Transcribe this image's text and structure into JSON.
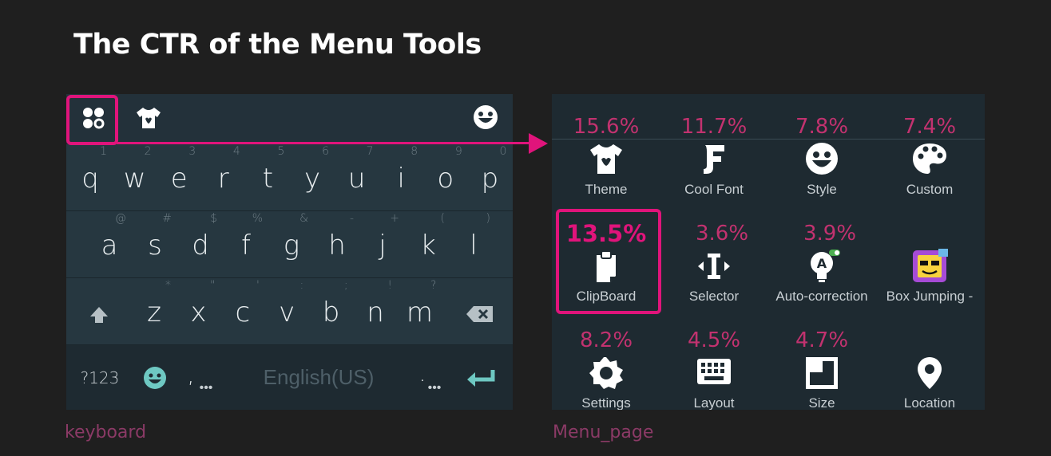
{
  "title": "The CTR of the Menu Tools",
  "captions": {
    "keyboard": "keyboard",
    "menu": "Menu_page"
  },
  "colors": {
    "accent": "#e0147b",
    "percent": "#c2326f",
    "background": "#1f1f1f",
    "keyboard_bg": "#263740"
  },
  "keyboard": {
    "toolbar_icons": [
      "menu-grid-icon",
      "theme-shirt-icon",
      "emoji-face-icon"
    ],
    "row1": [
      {
        "k": "q",
        "h": "1"
      },
      {
        "k": "w",
        "h": "2"
      },
      {
        "k": "e",
        "h": "3"
      },
      {
        "k": "r",
        "h": "4"
      },
      {
        "k": "t",
        "h": "5"
      },
      {
        "k": "y",
        "h": "6"
      },
      {
        "k": "u",
        "h": "7"
      },
      {
        "k": "i",
        "h": "8"
      },
      {
        "k": "o",
        "h": "9"
      },
      {
        "k": "p",
        "h": "0"
      }
    ],
    "row2": [
      {
        "k": "a",
        "h": "@"
      },
      {
        "k": "s",
        "h": "#"
      },
      {
        "k": "d",
        "h": "$"
      },
      {
        "k": "f",
        "h": "%"
      },
      {
        "k": "g",
        "h": "&"
      },
      {
        "k": "h",
        "h": "-"
      },
      {
        "k": "j",
        "h": "+"
      },
      {
        "k": "k",
        "h": "("
      },
      {
        "k": "l",
        "h": ")"
      }
    ],
    "row3": [
      {
        "k": "z",
        "h": "*"
      },
      {
        "k": "x",
        "h": "\""
      },
      {
        "k": "c",
        "h": "'"
      },
      {
        "k": "v",
        "h": ":"
      },
      {
        "k": "b",
        "h": ";"
      },
      {
        "k": "n",
        "h": "!"
      },
      {
        "k": "m",
        "h": "?"
      }
    ],
    "symbols_key": "?123",
    "comma_key": ",",
    "period_key": ".",
    "language": "English(US)"
  },
  "menu": {
    "items": [
      {
        "label": "Theme",
        "ctr": "15.6%",
        "icon": "shirt-icon"
      },
      {
        "label": "Cool Font",
        "ctr": "11.7%",
        "icon": "font-icon"
      },
      {
        "label": "Style",
        "ctr": "7.8%",
        "icon": "smiley-icon"
      },
      {
        "label": "Custom",
        "ctr": "7.4%",
        "icon": "palette-icon"
      },
      {
        "label": "ClipBoard",
        "ctr": "13.5%",
        "icon": "clipboard-icon"
      },
      {
        "label": "Selector",
        "ctr": "3.6%",
        "icon": "text-cursor-icon"
      },
      {
        "label": "Auto-correction",
        "ctr": "3.9%",
        "icon": "bulb-icon"
      },
      {
        "label": "Box Jumping -",
        "ctr": "",
        "icon": "game-ad-icon"
      },
      {
        "label": "Settings",
        "ctr": "8.2%",
        "icon": "gear-icon"
      },
      {
        "label": "Layout",
        "ctr": "4.5%",
        "icon": "keyboard-layout-icon"
      },
      {
        "label": "Size",
        "ctr": "4.7%",
        "icon": "resize-icon"
      },
      {
        "label": "Location",
        "ctr": "",
        "icon": "location-pin-icon"
      }
    ]
  }
}
